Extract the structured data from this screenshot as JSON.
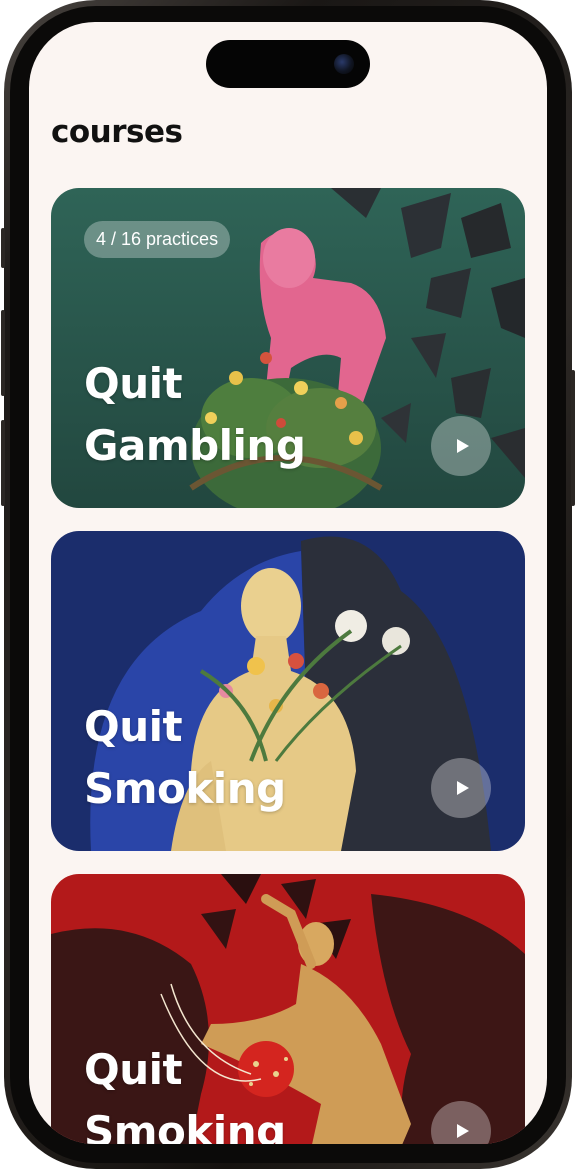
{
  "page": {
    "title": "courses"
  },
  "courses": [
    {
      "title_line1": "Quit",
      "title_line2": "Gambling",
      "progress_badge": "4 / 16 practices",
      "theme_color": "#2f5a50"
    },
    {
      "title_line1": "Quit",
      "title_line2": "Smoking",
      "theme_color": "#1d2f6e"
    },
    {
      "title_line1": "Quit",
      "title_line2": "Smoking",
      "theme_color": "#b3191a"
    }
  ],
  "icons": {
    "play": "play-icon"
  }
}
